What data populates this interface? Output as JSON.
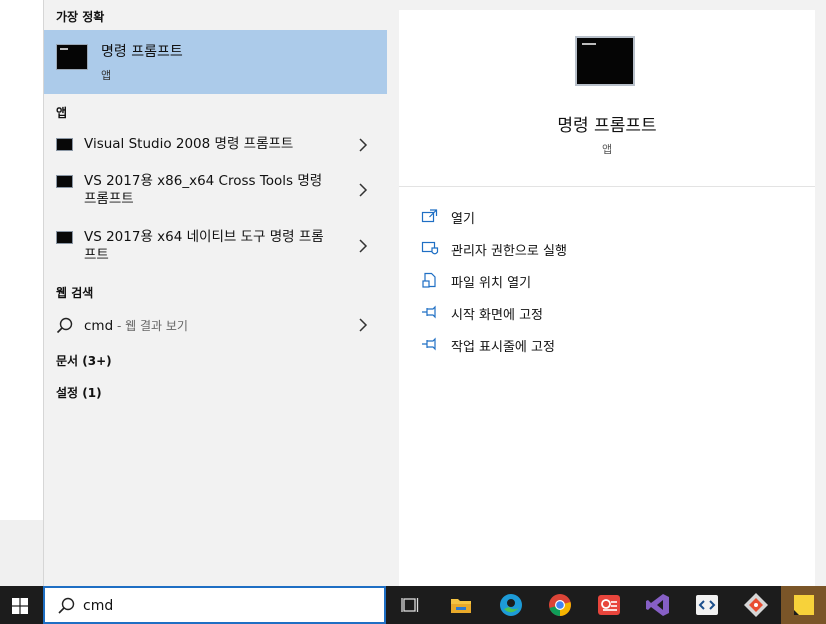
{
  "left": {
    "best_match_heading": "가장 정확",
    "best_match": {
      "title": "명령 프롬프트",
      "subtitle": "앱"
    },
    "apps_heading": "앱",
    "apps": [
      {
        "label": "Visual Studio 2008 명령 프롬프트"
      },
      {
        "label": "VS 2017용 x86_x64 Cross Tools 명령 프롬프트"
      },
      {
        "label": "VS 2017용 x64 네이티브 도구 명령 프롬프트"
      }
    ],
    "web_heading": "웹 검색",
    "web": {
      "query": "cmd",
      "suffix": " - 웹 결과 보기"
    },
    "documents_heading": "문서 (3+)",
    "settings_heading": "설정 (1)"
  },
  "detail": {
    "title": "명령 프롬프트",
    "subtitle": "앱",
    "actions": [
      {
        "label": "열기",
        "icon": "open-icon"
      },
      {
        "label": "관리자 권한으로 실행",
        "icon": "shield-icon"
      },
      {
        "label": "파일 위치 열기",
        "icon": "file-location-icon"
      },
      {
        "label": "시작 화면에 고정",
        "icon": "pin-icon"
      },
      {
        "label": "작업 표시줄에 고정",
        "icon": "pin-icon"
      }
    ]
  },
  "taskbar": {
    "search_value": "cmd",
    "icons": [
      "task-view-icon",
      "file-explorer-icon",
      "edge-icon",
      "chrome-icon",
      "office-icon",
      "visual-studio-icon",
      "dev-tool-icon",
      "git-icon",
      "sticky-notes-icon"
    ]
  },
  "colors": {
    "selection": "#accbea",
    "accent": "#1f6fc4",
    "taskbar": "#1c1c1c"
  }
}
